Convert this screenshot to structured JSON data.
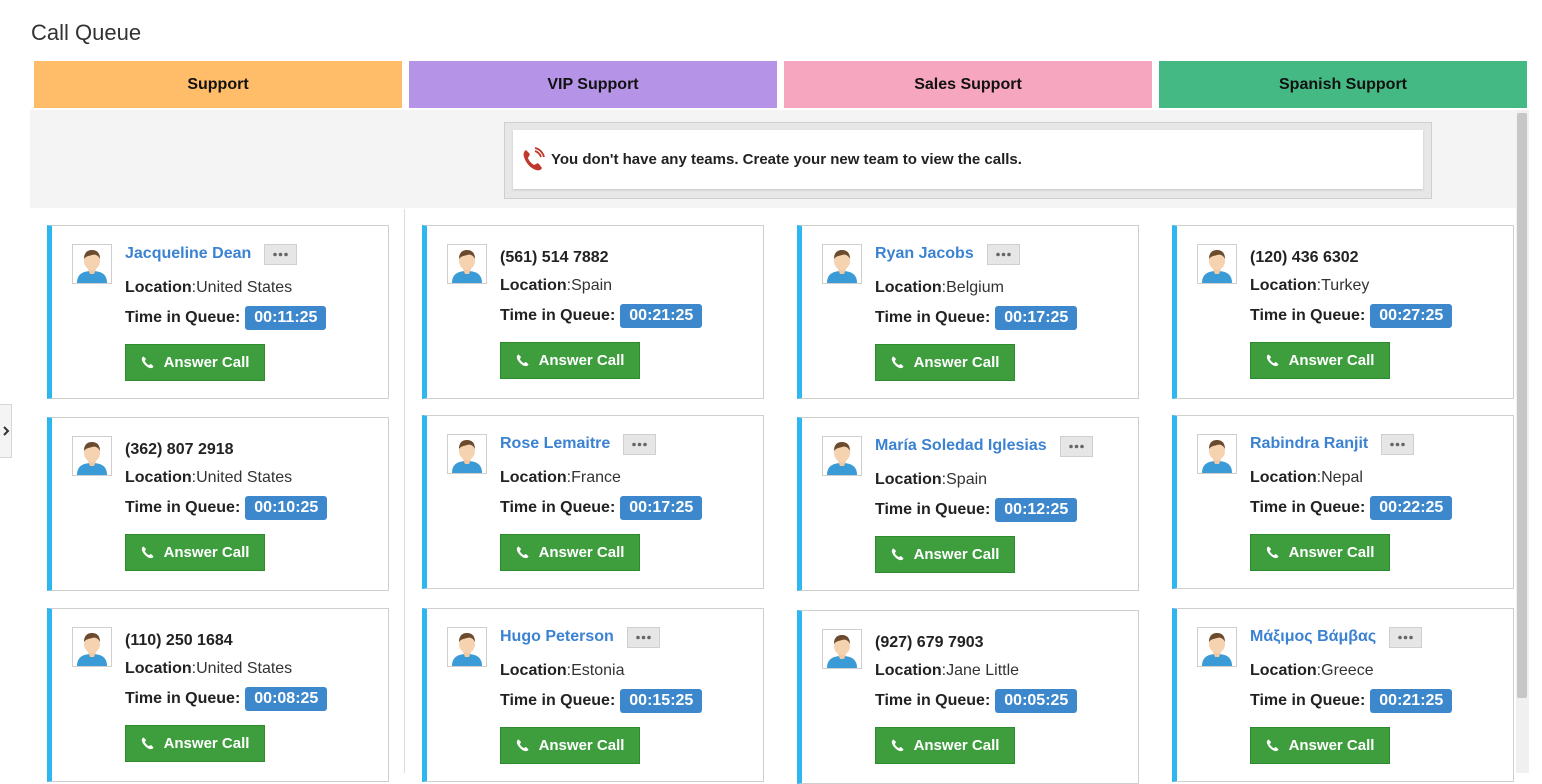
{
  "page": {
    "title": "Call Queue"
  },
  "colors": {
    "accent_bar": "#2eb6f0",
    "name_link": "#3b82d2",
    "time_badge": "#3d88cc",
    "answer_button": "#3e9e3e"
  },
  "queues": [
    {
      "label": "Support",
      "color": "#ffbd69"
    },
    {
      "label": "VIP Support",
      "color": "#b594e8"
    },
    {
      "label": "Sales Support",
      "color": "#f7a6bf"
    },
    {
      "label": "Spanish Support",
      "color": "#45b983"
    }
  ],
  "notice": {
    "icon": "phone-call-icon",
    "text": "You don't have any teams. Create your new team to view the calls."
  },
  "labels": {
    "location": "Location",
    "time_in_queue": "Time in Queue:",
    "answer_call": "Answer Call"
  },
  "icons": {
    "sidebar_toggle": "chevron-right-icon",
    "more": "ellipsis-icon",
    "phone": "phone-icon",
    "avatar": "user-avatar-icon"
  },
  "calls": [
    {
      "caller": "Jacqueline Dean",
      "is_name": true,
      "location": "United States",
      "time": "00:11:25"
    },
    {
      "caller": "(561) 514 7882",
      "is_name": false,
      "location": "Spain",
      "time": "00:21:25"
    },
    {
      "caller": "Ryan Jacobs",
      "is_name": true,
      "location": "Belgium",
      "time": "00:17:25"
    },
    {
      "caller": "(120) 436 6302",
      "is_name": false,
      "location": "Turkey",
      "time": "00:27:25"
    },
    {
      "caller": "(362) 807 2918",
      "is_name": false,
      "location": "United States",
      "time": "00:10:25"
    },
    {
      "caller": "Rose Lemaitre",
      "is_name": true,
      "location": "France",
      "time": "00:17:25"
    },
    {
      "caller": "María Soledad Iglesias",
      "is_name": true,
      "location": "Spain",
      "time": "00:12:25"
    },
    {
      "caller": "Rabindra Ranjit",
      "is_name": true,
      "location": "Nepal",
      "time": "00:22:25"
    },
    {
      "caller": "(110) 250 1684",
      "is_name": false,
      "location": "United States",
      "time": "00:08:25"
    },
    {
      "caller": "Hugo Peterson",
      "is_name": true,
      "location": "Estonia",
      "time": "00:15:25"
    },
    {
      "caller": "(927) 679 7903",
      "is_name": false,
      "location": "Jane Little",
      "time": "00:05:25"
    },
    {
      "caller": "Μάξιμος Βάμβας",
      "is_name": true,
      "location": "Greece",
      "time": "00:21:25"
    }
  ]
}
